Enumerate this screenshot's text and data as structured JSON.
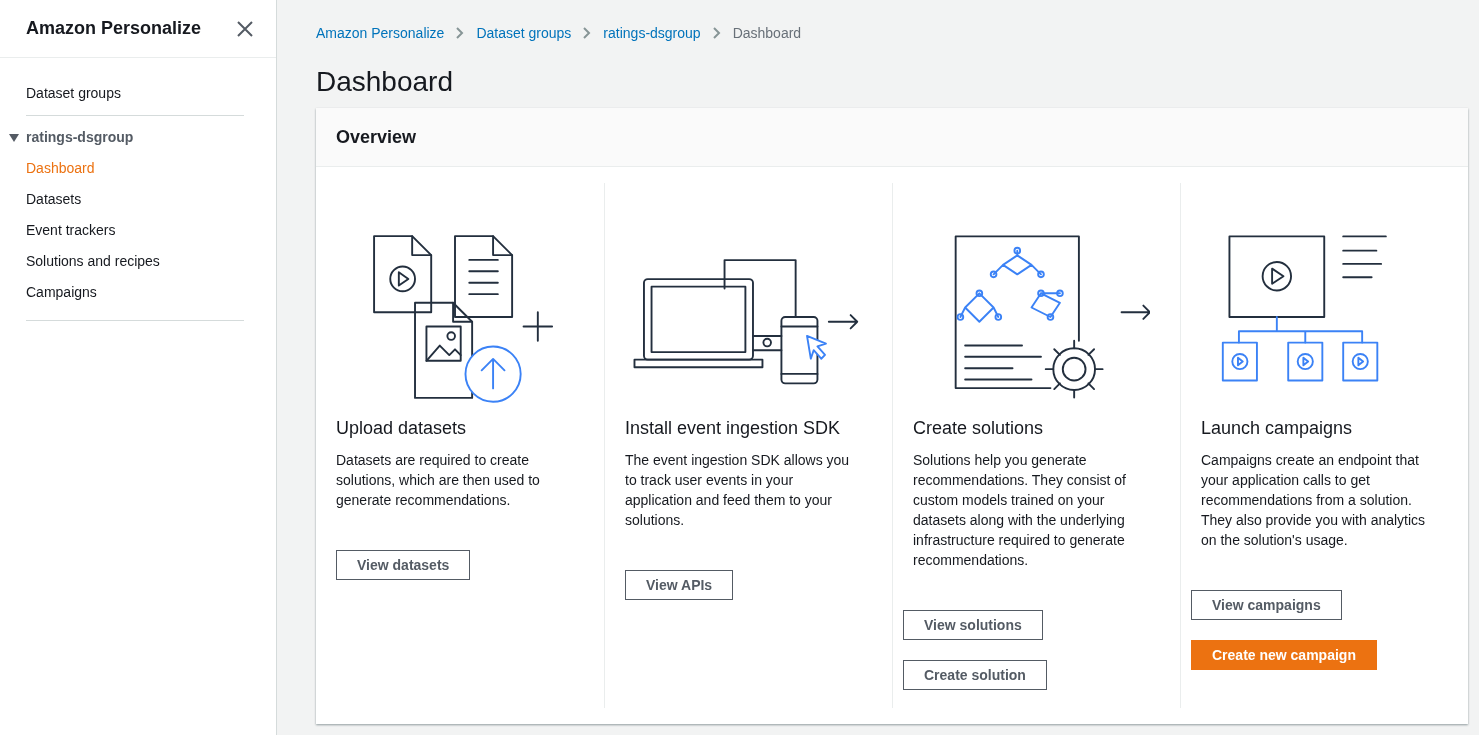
{
  "sidebar": {
    "title": "Amazon Personalize",
    "top_items": [
      {
        "label": "Dataset groups",
        "selected": false
      }
    ],
    "group": {
      "label": "ratings-dsgroup",
      "expanded": true,
      "children": [
        {
          "label": "Dashboard",
          "selected": true
        },
        {
          "label": "Datasets",
          "selected": false
        },
        {
          "label": "Event trackers",
          "selected": false
        },
        {
          "label": "Solutions and recipes",
          "selected": false
        },
        {
          "label": "Campaigns",
          "selected": false
        }
      ]
    }
  },
  "breadcrumbs": [
    {
      "label": "Amazon Personalize",
      "kind": "link"
    },
    {
      "label": "Dataset groups",
      "kind": "link"
    },
    {
      "label": "ratings-dsgroup",
      "kind": "link"
    },
    {
      "label": "Dashboard",
      "kind": "current"
    }
  ],
  "page_title": "Dashboard",
  "overview": {
    "title": "Overview",
    "steps": [
      {
        "kind": "upload",
        "title": "Upload datasets",
        "description": "Datasets are required to create solutions, which are then used to generate recommendations.",
        "buttons": [
          {
            "label": "View datasets",
            "kind": "normal"
          }
        ]
      },
      {
        "kind": "sdk",
        "title": "Install event ingestion SDK",
        "description": "The event ingestion SDK allows you to track user events in your application and feed them to your solutions.",
        "buttons": [
          {
            "label": "View APIs",
            "kind": "normal"
          }
        ]
      },
      {
        "kind": "solutions",
        "title": "Create solutions",
        "description": "Solutions help you generate recommendations. They consist of custom models trained on your datasets along with the underlying infrastructure required to generate recommendations.",
        "buttons": [
          {
            "label": "View solutions",
            "kind": "normal"
          },
          {
            "label": "Create solution",
            "kind": "normal"
          }
        ]
      },
      {
        "kind": "campaigns",
        "title": "Launch campaigns",
        "description": "Campaigns create an endpoint that your application calls to get recommendations from a solution. They also provide you with analytics on the solution's usage.",
        "buttons": [
          {
            "label": "View campaigns",
            "kind": "normal"
          },
          {
            "label": "Create new campaign",
            "kind": "primary"
          }
        ]
      }
    ]
  }
}
